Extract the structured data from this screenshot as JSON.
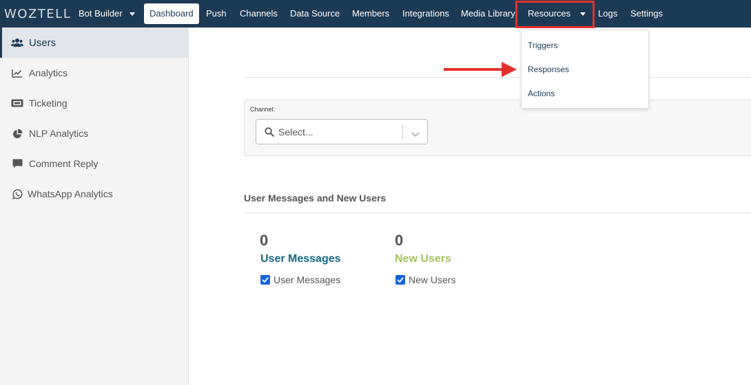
{
  "nav": {
    "logo": "WOZTELL",
    "items": [
      {
        "label": "Bot Builder",
        "dropdown": true
      },
      {
        "label": "Dashboard",
        "active": true
      },
      {
        "label": "Push"
      },
      {
        "label": "Channels"
      },
      {
        "label": "Data Source"
      },
      {
        "label": "Members"
      },
      {
        "label": "Integrations"
      },
      {
        "label": "Media Library"
      },
      {
        "label": "Resources",
        "dropdown": true,
        "highlighted": true
      },
      {
        "label": "Logs"
      },
      {
        "label": "Settings"
      }
    ]
  },
  "resources_menu": {
    "items": [
      {
        "label": "Triggers"
      },
      {
        "label": "Responses"
      },
      {
        "label": "Actions"
      }
    ]
  },
  "sidebar": {
    "items": [
      {
        "label": "Users",
        "icon": "users-icon",
        "active": true
      },
      {
        "label": "Analytics",
        "icon": "chart-line-icon"
      },
      {
        "label": "Ticketing",
        "icon": "ticket-icon"
      },
      {
        "label": "NLP Analytics",
        "icon": "pie-chart-icon"
      },
      {
        "label": "Comment Reply",
        "icon": "comment-icon"
      },
      {
        "label": "WhatsApp Analytics",
        "icon": "whatsapp-icon"
      }
    ]
  },
  "filter": {
    "channel_label": "Channel:",
    "select_placeholder": "Select..."
  },
  "section": {
    "title": "User Messages and New Users"
  },
  "stats": [
    {
      "value": "0",
      "label": "User Messages",
      "legend": "User Messages",
      "color": "#116a80"
    },
    {
      "value": "0",
      "label": "New Users",
      "legend": "New Users",
      "color": "#a5c25c"
    }
  ],
  "colors": {
    "nav_bg": "#1d3a55",
    "highlight": "#e4302b",
    "checkbox": "#1565d8"
  }
}
